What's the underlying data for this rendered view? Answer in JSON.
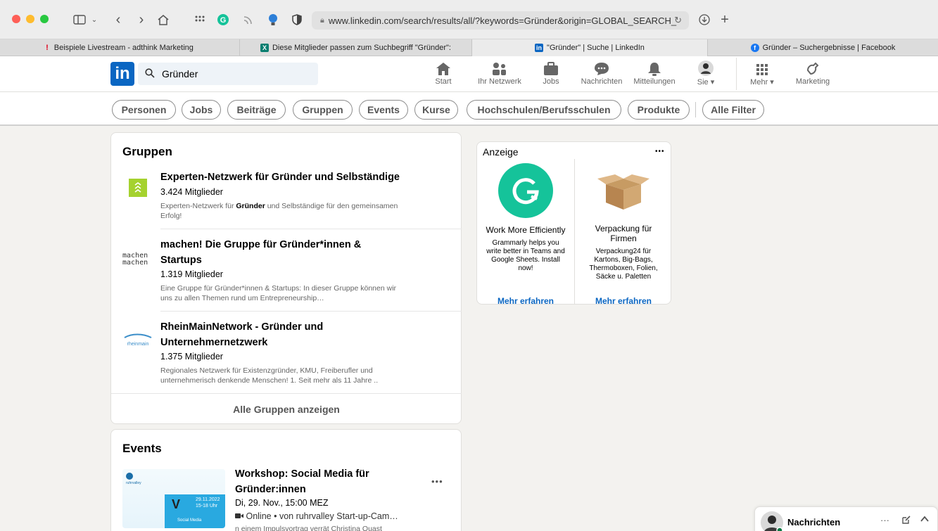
{
  "browser": {
    "url": "www.linkedin.com/search/results/all/?keywords=Gründer&origin=GLOBAL_SEARCH_",
    "tabs": [
      {
        "label": "Beispiele Livestream - adthink Marketing"
      },
      {
        "label": "Diese Mitglieder passen zum Suchbegriff \"Gründer\":"
      },
      {
        "label": "\"Gründer\" | Suche | LinkedIn"
      },
      {
        "label": "Gründer – Suchergebnisse | Facebook"
      }
    ]
  },
  "nav": {
    "logo": "in",
    "search_value": "Gründer",
    "items": [
      {
        "label": "Start",
        "icon": "home-icon"
      },
      {
        "label": "Ihr Netzwerk",
        "icon": "network-icon"
      },
      {
        "label": "Jobs",
        "icon": "briefcase-icon"
      },
      {
        "label": "Nachrichten",
        "icon": "chat-icon"
      },
      {
        "label": "Mitteilungen",
        "icon": "bell-icon"
      },
      {
        "label": "Sie ▾",
        "icon": "avatar"
      },
      {
        "label": "Mehr ▾",
        "icon": "grid-icon"
      },
      {
        "label": "Marketing",
        "icon": "compass-icon"
      }
    ]
  },
  "filters": [
    "Personen",
    "Jobs",
    "Beiträge",
    "Gruppen",
    "Events",
    "Kurse",
    "Hochschulen/Berufsschulen",
    "Produkte",
    "Alle Filter"
  ],
  "groups_card": {
    "title": "Gruppen",
    "groups": [
      {
        "name": "Experten-Netzwerk für Gründer und Selbständige",
        "members": "3.424 Mitglieder",
        "desc_pre": "Experten-Netzwerk für ",
        "desc_bold": "Gründer",
        "desc_post": " und Selbständige für den gemeinsamen Erfolg!"
      },
      {
        "name": "machen! Die Gruppe für Gründer*innen & Startups",
        "members": "1.319 Mitglieder",
        "desc": "Eine Gruppe für Gründer*innen & Startups: In dieser Gruppe können wir uns zu allen Themen rund um Entrepreneurship…",
        "logo_text": "machen machen"
      },
      {
        "name": "RheinMainNetwork - Gründer und Unternehmernetzwerk",
        "members": "1.375 Mitglieder",
        "desc": "Regionales Netzwerk für Existenzgründer, KMU, Freiberufler und unternehmerisch denkende Menschen!   1. Seit mehr als 11 Jahre  ..",
        "logo_text": "rheinmain"
      }
    ],
    "show_all": "Alle Gruppen anzeigen"
  },
  "events_card": {
    "title": "Events",
    "event": {
      "title": "Workshop: Social Media für Gründer:innen",
      "date": "Di, 29. Nov., 15:00 MEZ",
      "meta": "Online • von ruhrvalley Start-up-Cam…",
      "desc": "n einem Impulsvortrag verrät Christina Quast",
      "thumb_date": "29.11.2022",
      "thumb_time": "15-18 Uhr",
      "thumb_brand": "ruhrvalley",
      "thumb_caption": "Social Media"
    },
    "more": "•••"
  },
  "ad": {
    "label": "Anzeige",
    "more": "•••",
    "items": [
      {
        "title": "Work More Efficiently",
        "text": "Grammarly helps you write better in Teams and Google Sheets. Install now!",
        "link": "Mehr erfahren"
      },
      {
        "title": "Verpackung für Firmen",
        "text": "Verpackung24 für Kartons, Big-Bags, Thermoboxen, Folien, Säcke u. Paletten",
        "link": "Mehr erfahren"
      }
    ]
  },
  "messaging": {
    "label": "Nachrichten",
    "more": "···"
  },
  "colors": {
    "brand": "#0a66c2",
    "grammarly": "#15c39a",
    "bg": "#f3f2ef"
  }
}
